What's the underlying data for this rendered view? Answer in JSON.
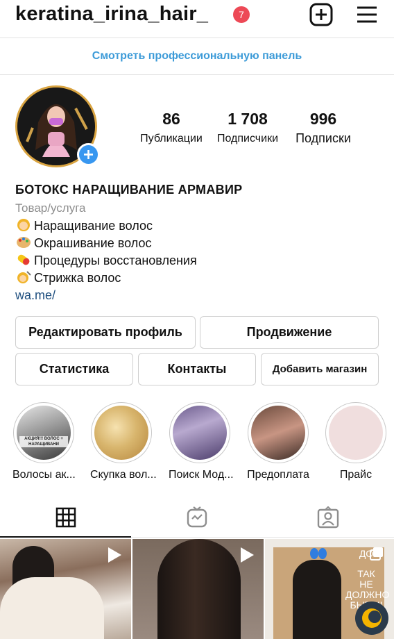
{
  "header": {
    "username": "keratina_irina_hair_",
    "notification_count": "7"
  },
  "pro_panel": {
    "label": "Смотреть профессиональную панель"
  },
  "stats": {
    "posts": {
      "value": "86",
      "label": "Публикации"
    },
    "followers": {
      "value": "1 708",
      "label": "Подписчики"
    },
    "following": {
      "value": "996",
      "label": "Подписки"
    }
  },
  "bio": {
    "name": "БОТОКС НАРАЩИВАНИЕ АРМАВИР",
    "category": "Товар/услуга",
    "lines": [
      {
        "emoji": "woman-icon",
        "text": "Наращивание волос"
      },
      {
        "emoji": "palette-icon",
        "text": "Окрашивание волос"
      },
      {
        "emoji": "pill-icon",
        "text": "Процедуры восстановления"
      },
      {
        "emoji": "haircut-icon",
        "text": "Стрижка волос"
      }
    ],
    "link": "wa.me/"
  },
  "buttons": {
    "edit_profile": "Редактировать профиль",
    "promotion": "Продвижение",
    "statistics": "Статистика",
    "contacts": "Контакты",
    "add_shop": "Добавить магазин"
  },
  "highlights": [
    {
      "label": "Волосы ак...",
      "thumb_text": "АКЦИЯ!!! ВОЛОС + НАРАЩИВАНИ"
    },
    {
      "label": "Скупка вол..."
    },
    {
      "label": "Поиск Мод..."
    },
    {
      "label": "Предоплата"
    },
    {
      "label": "Прайс"
    }
  ],
  "tabs": [
    "grid-icon",
    "igtv-icon",
    "tagged-icon"
  ],
  "posts": [
    {
      "type": "video"
    },
    {
      "type": "video"
    },
    {
      "type": "multiple",
      "overlay_text": [
        "ДО",
        "ТАК",
        "НЕ",
        "ДОЛЖНО",
        "БЫТЬ!!"
      ]
    }
  ],
  "colors": {
    "accent_blue": "#3897f0",
    "pro_panel_text": "#3d9bd8",
    "notification_red": "#ed4956",
    "avatar_ring": "#d9a441",
    "link": "#1f4f7f",
    "muted": "#8e8e8e"
  }
}
